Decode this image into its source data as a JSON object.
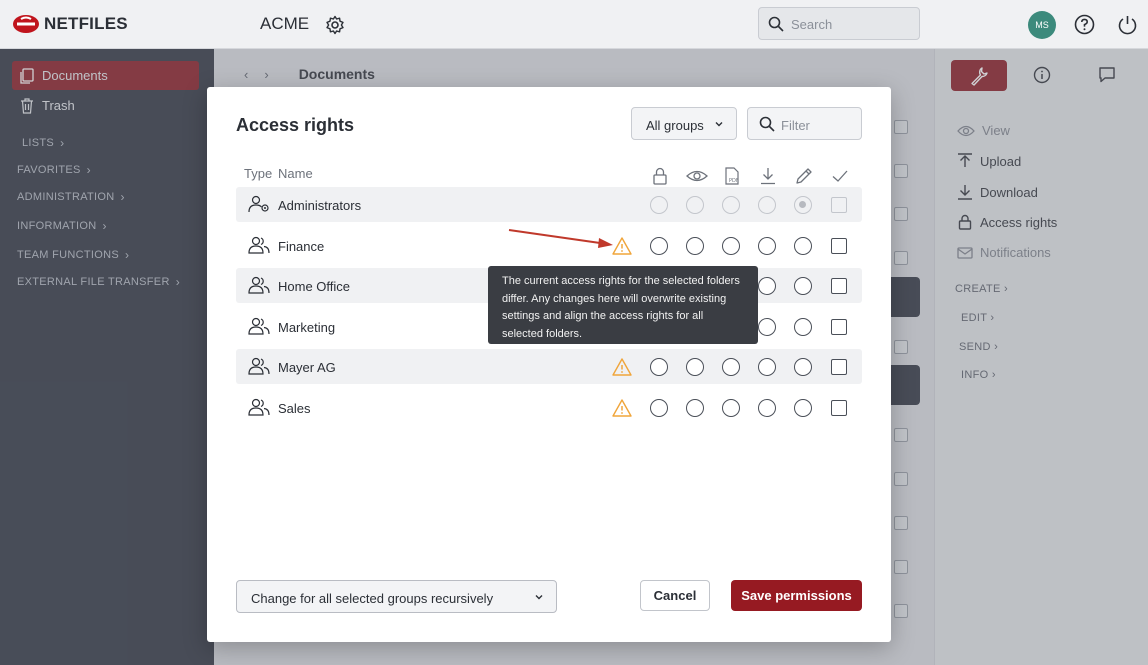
{
  "app": {
    "logo_text": "NETFILES",
    "workspace": "ACME",
    "search_placeholder": "Search",
    "avatar_initials": "MS"
  },
  "sidebar": {
    "items": [
      {
        "label": "Documents",
        "active": true
      },
      {
        "label": "Trash",
        "active": false
      }
    ],
    "categories": [
      "LISTS",
      "FAVORITES",
      "ADMINISTRATION",
      "INFORMATION",
      "TEAM FUNCTIONS",
      "EXTERNAL FILE TRANSFER"
    ]
  },
  "main": {
    "breadcrumb_title": "Documents"
  },
  "right_panel": {
    "items": [
      {
        "label": "View",
        "enabled": false
      },
      {
        "label": "Upload",
        "enabled": true
      },
      {
        "label": "Download",
        "enabled": true
      },
      {
        "label": "Access rights",
        "enabled": true
      },
      {
        "label": "Notifications",
        "enabled": false
      }
    ],
    "categories": [
      "CREATE",
      "EDIT",
      "SEND",
      "INFO"
    ]
  },
  "modal": {
    "title": "Access rights",
    "group_filter": {
      "selected": "All groups"
    },
    "filter_placeholder": "Filter",
    "columns": {
      "type": "Type",
      "name": "Name"
    },
    "permission_icons": [
      "lock-icon",
      "eye-icon",
      "pdf-icon",
      "download-icon",
      "pencil-icon",
      "check-icon"
    ],
    "groups": [
      {
        "name": "Administrators",
        "warning": false,
        "disabled": true
      },
      {
        "name": "Finance",
        "warning": true,
        "disabled": false
      },
      {
        "name": "Home Office",
        "warning": false,
        "disabled": false
      },
      {
        "name": "Marketing",
        "warning": false,
        "disabled": false
      },
      {
        "name": "Mayer AG",
        "warning": true,
        "disabled": false
      },
      {
        "name": "Sales",
        "warning": true,
        "disabled": false
      }
    ],
    "tooltip": "The current access rights for the selected folders differ. Any changes here will overwrite existing settings and align the access rights for all selected folders.",
    "recursive_select": "Change for all selected groups recursively",
    "cancel_label": "Cancel",
    "save_label": "Save permissions"
  },
  "colors": {
    "brand": "#961a22",
    "sidebar": "#2e3440",
    "warning": "#f0a53a",
    "annotation_arrow": "#c0392b"
  }
}
